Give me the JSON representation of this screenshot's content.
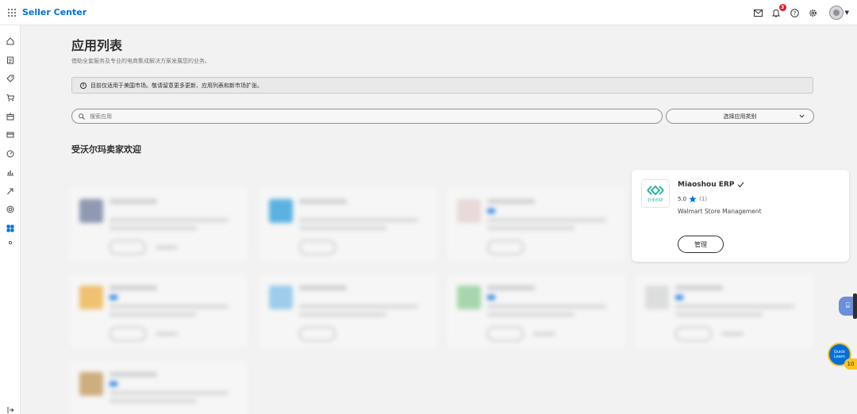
{
  "header": {
    "brand": "Seller Center",
    "notification_count": "3",
    "icons": [
      "grid-icon",
      "mail-icon",
      "bell-icon",
      "help-icon",
      "gear-icon",
      "avatar",
      "chevron-down-icon"
    ]
  },
  "sidebar": {
    "items": [
      "home-icon",
      "orders-icon",
      "tag-icon",
      "cart-icon",
      "inventory-icon",
      "payment-icon",
      "performance-icon",
      "analytics-icon",
      "growth-icon",
      "target-icon",
      "apps-icon",
      "dot-icon"
    ]
  },
  "page": {
    "title": "应用列表",
    "subtitle": "借助全套服务及专业的电商集成解决方案发展您的业务。",
    "notice": "目前仅适用于美国市场。敬请留意更多更新、应用列表和新市场扩张。",
    "search_placeholder": "搜索应用",
    "category_select": "选择应用类别",
    "section_title": "受沃尔玛卖家欢迎"
  },
  "featured_app": {
    "name": "Miaoshou ERP",
    "logo_text": "妙手ERP",
    "rating": "5.0",
    "rating_count": "(1)",
    "description": "Walmart Store Management",
    "button_label": "管理"
  },
  "widgets": {
    "quick_label_1": "Quick",
    "quick_label_2": "Learn",
    "quick_count": "10"
  },
  "colors": {
    "brand": "#0071dc",
    "accent_yellow": "#ffc220",
    "logo_teal": "#2fb4a0"
  }
}
